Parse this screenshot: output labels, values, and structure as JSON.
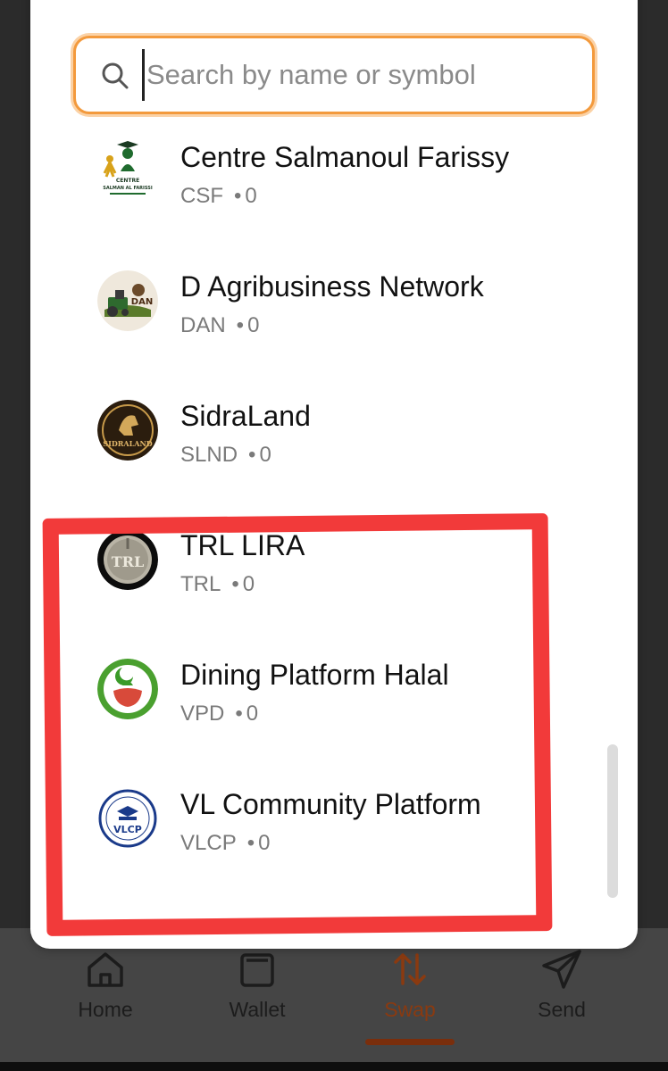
{
  "search": {
    "placeholder": "Search by name or symbol"
  },
  "tokens": [
    {
      "name": "Centre Salmanoul Farissy",
      "symbol": "CSF",
      "balance": "0",
      "icon": "centre-salmanoul-farissy-logo"
    },
    {
      "name": "D Agribusiness Network",
      "symbol": "DAN",
      "balance": "0",
      "icon": "dan-logo"
    },
    {
      "name": "SidraLand",
      "symbol": "SLND",
      "balance": "0",
      "icon": "sidraland-logo"
    },
    {
      "name": "TRL LIRA",
      "symbol": "TRL",
      "balance": "0",
      "icon": "trl-lira-logo"
    },
    {
      "name": "Dining Platform Halal",
      "symbol": "VPD",
      "balance": "0",
      "icon": "dining-platform-halal-logo"
    },
    {
      "name": "VL Community Platform",
      "symbol": "VLCP",
      "balance": "0",
      "icon": "vlcp-logo"
    }
  ],
  "logo_text": {
    "csf_line1": "CENTRE",
    "csf_line2": "SALMAN AL FARISSI",
    "dan": "DAN",
    "sidraland": "SIDRALAND",
    "trl": "TRL",
    "vlcp": "VLCP"
  },
  "bottom_nav": [
    {
      "label": "Home",
      "icon": "home-icon",
      "active": false
    },
    {
      "label": "Wallet",
      "icon": "wallet-icon",
      "active": false
    },
    {
      "label": "Swap",
      "icon": "swap-icon",
      "active": true
    },
    {
      "label": "Send",
      "icon": "send-icon",
      "active": false
    }
  ],
  "colors": {
    "accent": "#f39a3d",
    "highlight_box": "#f23a3a",
    "active_nav": "#8a3a10"
  }
}
